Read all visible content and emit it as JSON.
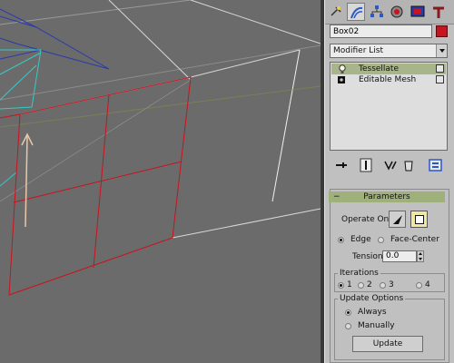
{
  "command_panel": {
    "tabs": [
      {
        "name": "create",
        "icon": "create-icon"
      },
      {
        "name": "modify",
        "icon": "modify-icon",
        "active": true
      },
      {
        "name": "hierarchy",
        "icon": "hierarchy-icon"
      },
      {
        "name": "motion",
        "icon": "motion-icon"
      },
      {
        "name": "display",
        "icon": "display-icon"
      },
      {
        "name": "utilities",
        "icon": "utilities-icon"
      }
    ],
    "object_name": "Box02",
    "object_color": "#c8141e",
    "modifier_list_label": "Modifier List",
    "modifier_stack": [
      {
        "label": "Tessellate",
        "selected": true,
        "icon": "bulb-icon"
      },
      {
        "label": "Editable Mesh",
        "selected": false,
        "icon": "expand-plus-icon"
      }
    ]
  },
  "parameters": {
    "title": "Parameters",
    "operate_on_label": "Operate On:",
    "edge_label": "Edge",
    "face_center_label": "Face-Center",
    "tension_label": "Tension:",
    "tension_value": "0.0",
    "iterations_title": "Iterations",
    "iterations": [
      "1",
      "2",
      "3",
      "4"
    ],
    "iterations_selected": "1",
    "update_options_title": "Update Options",
    "always_label": "Always",
    "manually_label": "Manually",
    "update_button": "Update"
  },
  "colors": {
    "viewport_bg": "#6b6b6b",
    "selection_red": "#c8141e",
    "panel_bg": "#c0c0c0",
    "rollout_header": "#9fb07a",
    "stack_selected": "#a8b48a"
  }
}
